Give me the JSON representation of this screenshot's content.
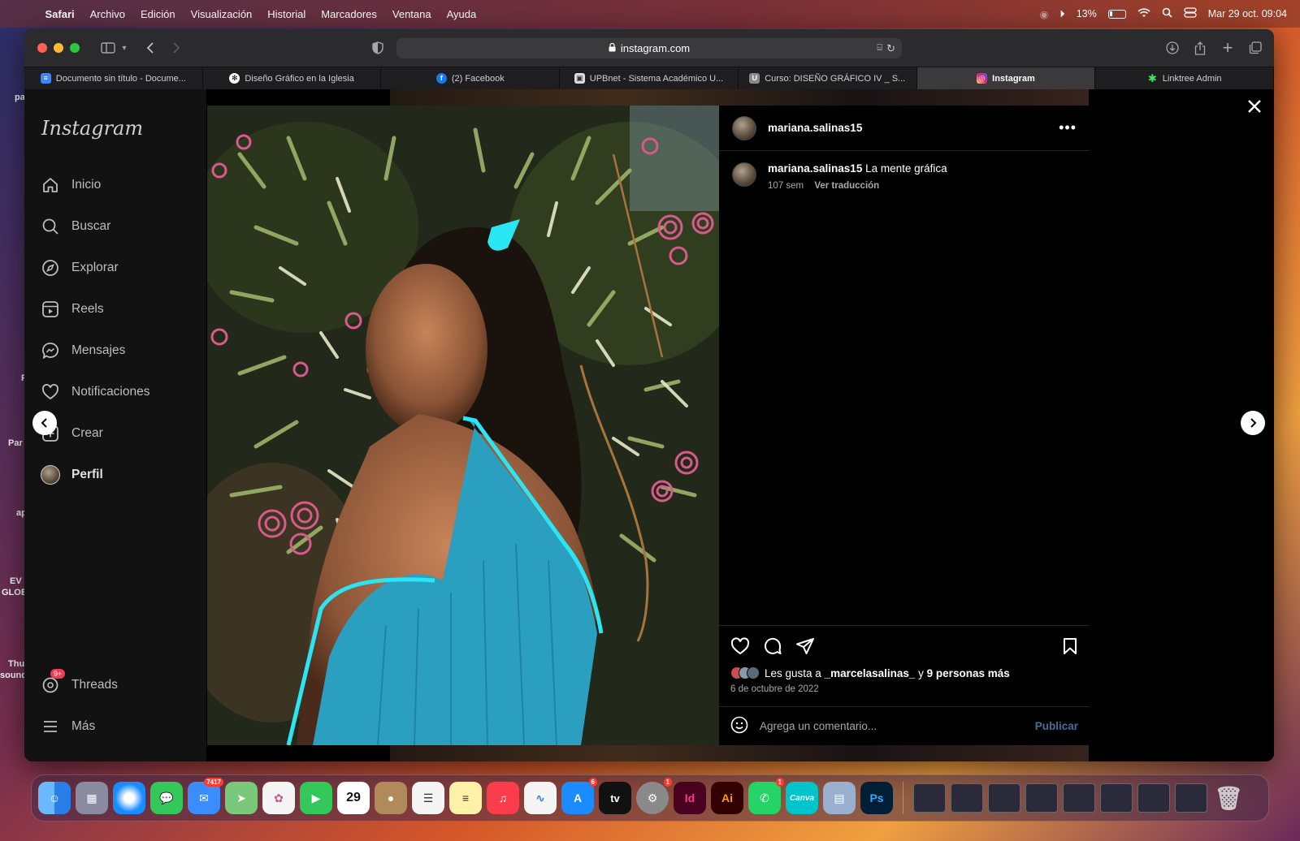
{
  "menubar": {
    "app": "Safari",
    "items": [
      "Archivo",
      "Edición",
      "Visualización",
      "Historial",
      "Marcadores",
      "Ventana",
      "Ayuda"
    ],
    "battery": "13%",
    "datetime": "Mar 29 oct. 09:04"
  },
  "desktop_labels": [
    "pa",
    "Par",
    "EV",
    "GLOB",
    "Thu",
    "sound",
    "ap",
    "P"
  ],
  "browser": {
    "url": "instagram.com",
    "tabs": [
      {
        "label": "Documento sin título - Docume...",
        "icon": "docs-icon",
        "color": "#4285f4"
      },
      {
        "label": "Diseño Gráfico en la Iglesia",
        "icon": "chatgpt-icon",
        "color": "#ffffff"
      },
      {
        "label": "(2) Facebook",
        "icon": "facebook-icon",
        "color": "#1877f2"
      },
      {
        "label": "UPBnet - Sistema Académico U...",
        "icon": "upbnet-icon",
        "color": "#cccccc"
      },
      {
        "label": "Curso: DISEÑO GRÁFICO IV _ S...",
        "icon": "course-icon",
        "color": "#888888"
      },
      {
        "label": "Instagram",
        "icon": "instagram-icon",
        "color": "#e1306c"
      },
      {
        "label": "Linktree Admin",
        "icon": "linktree-icon",
        "color": "#43e660"
      }
    ]
  },
  "instagram": {
    "logo": "Instagram",
    "nav": [
      {
        "label": "Inicio",
        "icon": "home-icon"
      },
      {
        "label": "Buscar",
        "icon": "search-icon"
      },
      {
        "label": "Explorar",
        "icon": "compass-icon"
      },
      {
        "label": "Reels",
        "icon": "reels-icon"
      },
      {
        "label": "Mensajes",
        "icon": "messenger-icon"
      },
      {
        "label": "Notificaciones",
        "icon": "heart-icon"
      },
      {
        "label": "Crear",
        "icon": "plus-square-icon"
      },
      {
        "label": "Perfil",
        "icon": "profile-avatar"
      }
    ],
    "threads": {
      "label": "Threads",
      "badge": "9+"
    },
    "more": "Más",
    "post": {
      "username": "mariana.salinas15",
      "caption": "La mente gráfica",
      "age": "107 sem",
      "translate": "Ver traducción",
      "likes_prefix": "Les gusta a ",
      "likes_user": "_marcelasalinas_",
      "likes_mid": " y ",
      "likes_others": "9 personas más",
      "date": "6 de octubre de 2022",
      "comment_placeholder": "Agrega un comentario...",
      "publish": "Publicar"
    }
  },
  "dock": {
    "apps": [
      {
        "name": "finder",
        "label": "",
        "color": "#1e7cf2"
      },
      {
        "name": "launchpad",
        "label": "",
        "color": "#6a6a8a"
      },
      {
        "name": "safari",
        "label": "",
        "color": "#1a8cff"
      },
      {
        "name": "messages",
        "label": "",
        "color": "#34c759"
      },
      {
        "name": "mail",
        "label": "",
        "color": "#3a8cff",
        "badge": "7417"
      },
      {
        "name": "maps",
        "label": "",
        "color": "#5ac85a"
      },
      {
        "name": "photos",
        "label": "",
        "color": "#f5f5f5"
      },
      {
        "name": "facetime",
        "label": "",
        "color": "#34c759"
      },
      {
        "name": "calendar",
        "label": "29",
        "color": "#ffffff"
      },
      {
        "name": "contacts",
        "label": "",
        "color": "#b08a5a"
      },
      {
        "name": "reminders",
        "label": "",
        "color": "#f5f5f5"
      },
      {
        "name": "notes",
        "label": "",
        "color": "#fff2a8"
      },
      {
        "name": "music",
        "label": "",
        "color": "#fa3c4c"
      },
      {
        "name": "freeform",
        "label": "",
        "color": "#f5f5f5"
      },
      {
        "name": "app-store",
        "label": "",
        "color": "#1a8cff",
        "badge": "6"
      },
      {
        "name": "apple-tv",
        "label": "tv",
        "color": "#111111"
      },
      {
        "name": "system-settings",
        "label": "",
        "color": "#8a8a8a",
        "badge": "1"
      },
      {
        "name": "indesign",
        "label": "Id",
        "color": "#49021f"
      },
      {
        "name": "illustrator",
        "label": "Ai",
        "color": "#330000"
      },
      {
        "name": "whatsapp",
        "label": "",
        "color": "#25d366",
        "badge": "1"
      },
      {
        "name": "canva",
        "label": "Canva",
        "color": "#00c4cc"
      },
      {
        "name": "preview",
        "label": "",
        "color": "#9ab0d0"
      },
      {
        "name": "photoshop",
        "label": "Ps",
        "color": "#001e36"
      }
    ]
  }
}
